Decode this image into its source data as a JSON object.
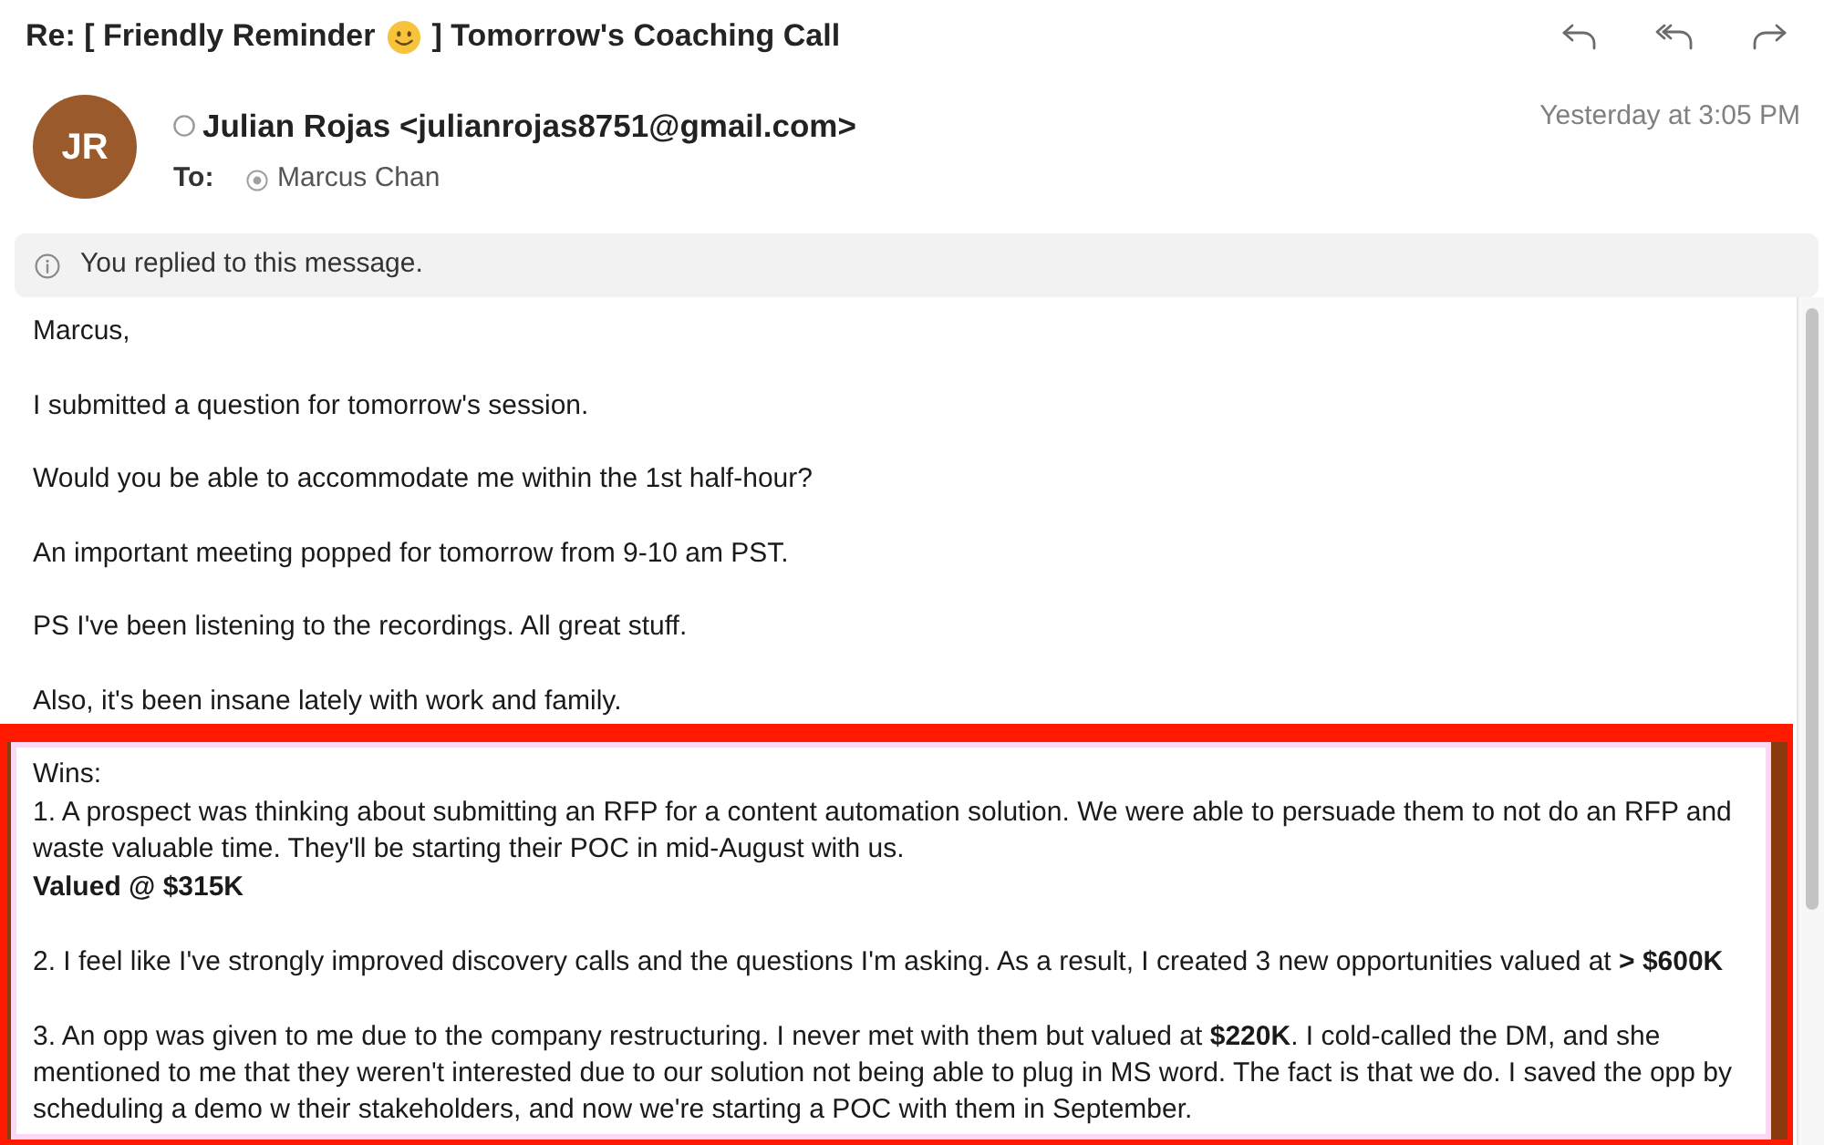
{
  "message": {
    "subject": {
      "before_emoji": "Re: [ Friendly Reminder",
      "after_emoji": "] Tomorrow's Coaching Call"
    },
    "sender": {
      "initials": "JR",
      "from": "Julian Rojas <julianrojas8751@gmail.com>"
    },
    "to_label": "To:",
    "recipients": [
      "Marcus Chan"
    ],
    "timestamp": "Yesterday at 3:05 PM",
    "notice": "You replied to this message.",
    "body": {
      "paragraphs": [
        "Marcus,",
        "I submitted a question for tomorrow's session.",
        "Would you be able to accommodate me within the 1st half-hour?",
        "An important meeting popped for tomorrow from 9-10 am PST.",
        "PS I've been listening to the recordings. All great stuff.",
        "Also, it's been insane lately with work and family."
      ],
      "wins": {
        "highlighted": true,
        "blocks": [
          {
            "lines": [
              {
                "text": "Wins:",
                "bold": false
              },
              {
                "text": "1. A prospect was thinking about submitting an RFP for a content automation solution. We were able to persuade them to not do an RFP and waste valuable time. They'll be starting their POC in mid-August with us.",
                "bold": false
              },
              {
                "text": "Valued @ $315K",
                "bold": true
              }
            ]
          },
          {
            "lines": [
              {
                "text": "2. I feel like I've strongly improved discovery calls and the questions I'm asking. As a result, I created 3 new opportunities valued at **> $600K**",
                "bold": false
              }
            ]
          },
          {
            "lines": [
              {
                "text": "3. An opp was given to me due to the company restructuring. I never met with them but valued at **$220K**. I cold-called the DM, and she mentioned to me that they weren't interested due to our solution not being able to plug in MS word. The fact is that we do. I saved the opp by scheduling a demo w their stakeholders, and now we're starting a POC with them in September.",
                "bold": false
              }
            ]
          }
        ]
      }
    }
  }
}
